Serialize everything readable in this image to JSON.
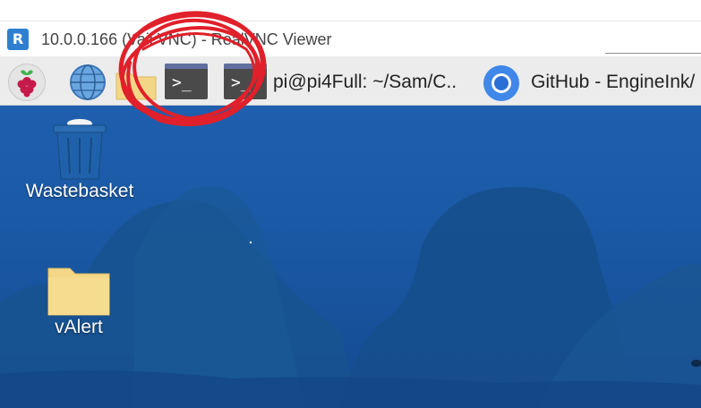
{
  "window": {
    "logo_text": "R",
    "title": "10.0.0.166 (Vail VNC) - RealVNC Viewer"
  },
  "taskbar": {
    "items": [
      {
        "name": "raspberry-menu",
        "icon": "raspberry-pi-icon"
      },
      {
        "name": "web-browser",
        "icon": "globe-icon"
      },
      {
        "name": "file-manager",
        "icon": "folder-icon"
      },
      {
        "name": "terminal",
        "icon": "terminal-icon",
        "prompt": ">_"
      },
      {
        "name": "terminal-window",
        "icon": "terminal-icon",
        "prompt": ">_",
        "label": "pi@pi4Full: ~/Sam/C.."
      },
      {
        "name": "chrome-window",
        "icon": "chrome-icon",
        "label": "GitHub - EngineInk/"
      }
    ]
  },
  "desktop": {
    "icons": [
      {
        "label": "Wastebasket",
        "icon": "trash-icon"
      },
      {
        "label": "vAlert",
        "icon": "folder-icon"
      }
    ]
  },
  "colors": {
    "desktop_blue": "#1e5fae",
    "taskbar_bg": "#ececec",
    "annotation_red": "#e0202a",
    "vnc_blue": "#2f7fd1"
  }
}
